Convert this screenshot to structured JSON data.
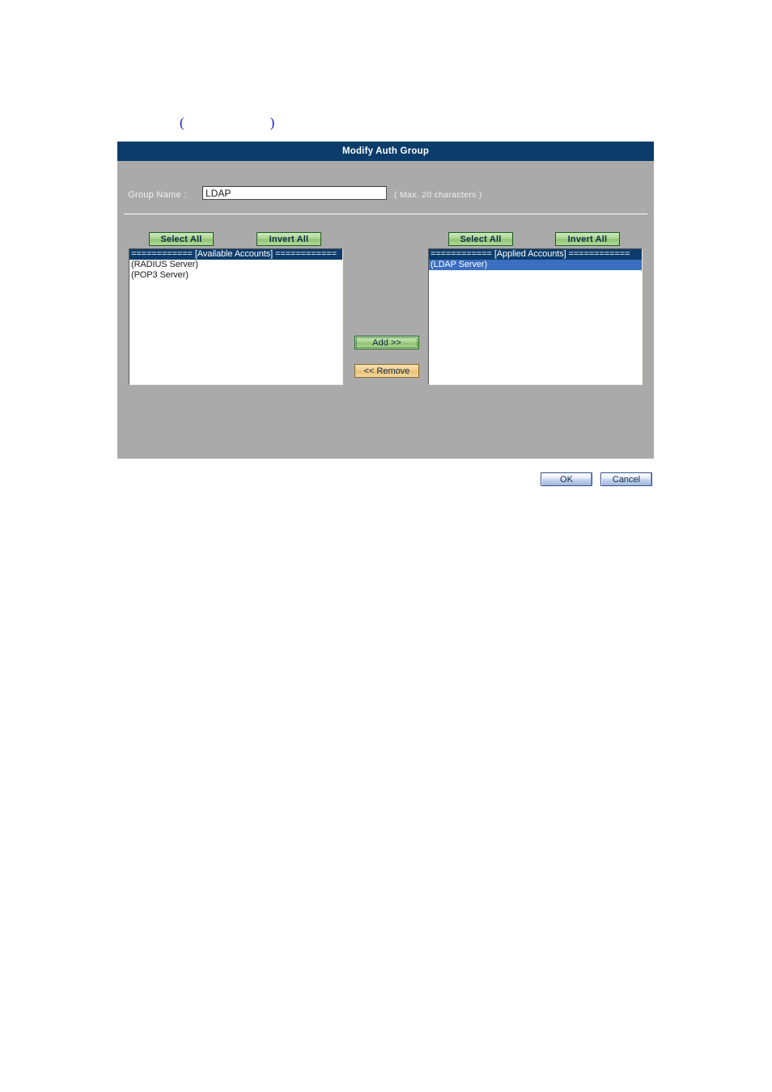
{
  "caption": {
    "text": "(                    )"
  },
  "dialog": {
    "title": "Modify Auth Group",
    "group_name": {
      "label": "Group Name :",
      "value": "LDAP",
      "placeholder": "",
      "hint": "( Max. 20 characters )"
    },
    "left_panel": {
      "select_all_label": "Select All",
      "invert_all_label": "Invert All",
      "items": [
        {
          "text": "============ [Available Accounts] ============",
          "state": "header"
        },
        {
          "text": "(RADIUS Server)",
          "state": "normal"
        },
        {
          "text": "(POP3 Server)",
          "state": "normal"
        }
      ]
    },
    "right_panel": {
      "select_all_label": "Select All",
      "invert_all_label": "Invert All",
      "items": [
        {
          "text": "============ [Applied Accounts] ============",
          "state": "header"
        },
        {
          "text": "(LDAP Server)",
          "state": "selected"
        }
      ]
    },
    "transfer": {
      "add_label": "Add >>",
      "remove_label": "<< Remove"
    }
  },
  "footer": {
    "ok_label": "OK",
    "cancel_label": "Cancel"
  },
  "colors": {
    "titlebar": "#0b3c6b",
    "panel_background": "#aaaaaa",
    "list_header": "#0b3c6b",
    "list_selection": "#3a6ec0",
    "green_button": "#a9d48e",
    "orange_button": "#f0cf92",
    "caption_text": "#1414d2"
  }
}
